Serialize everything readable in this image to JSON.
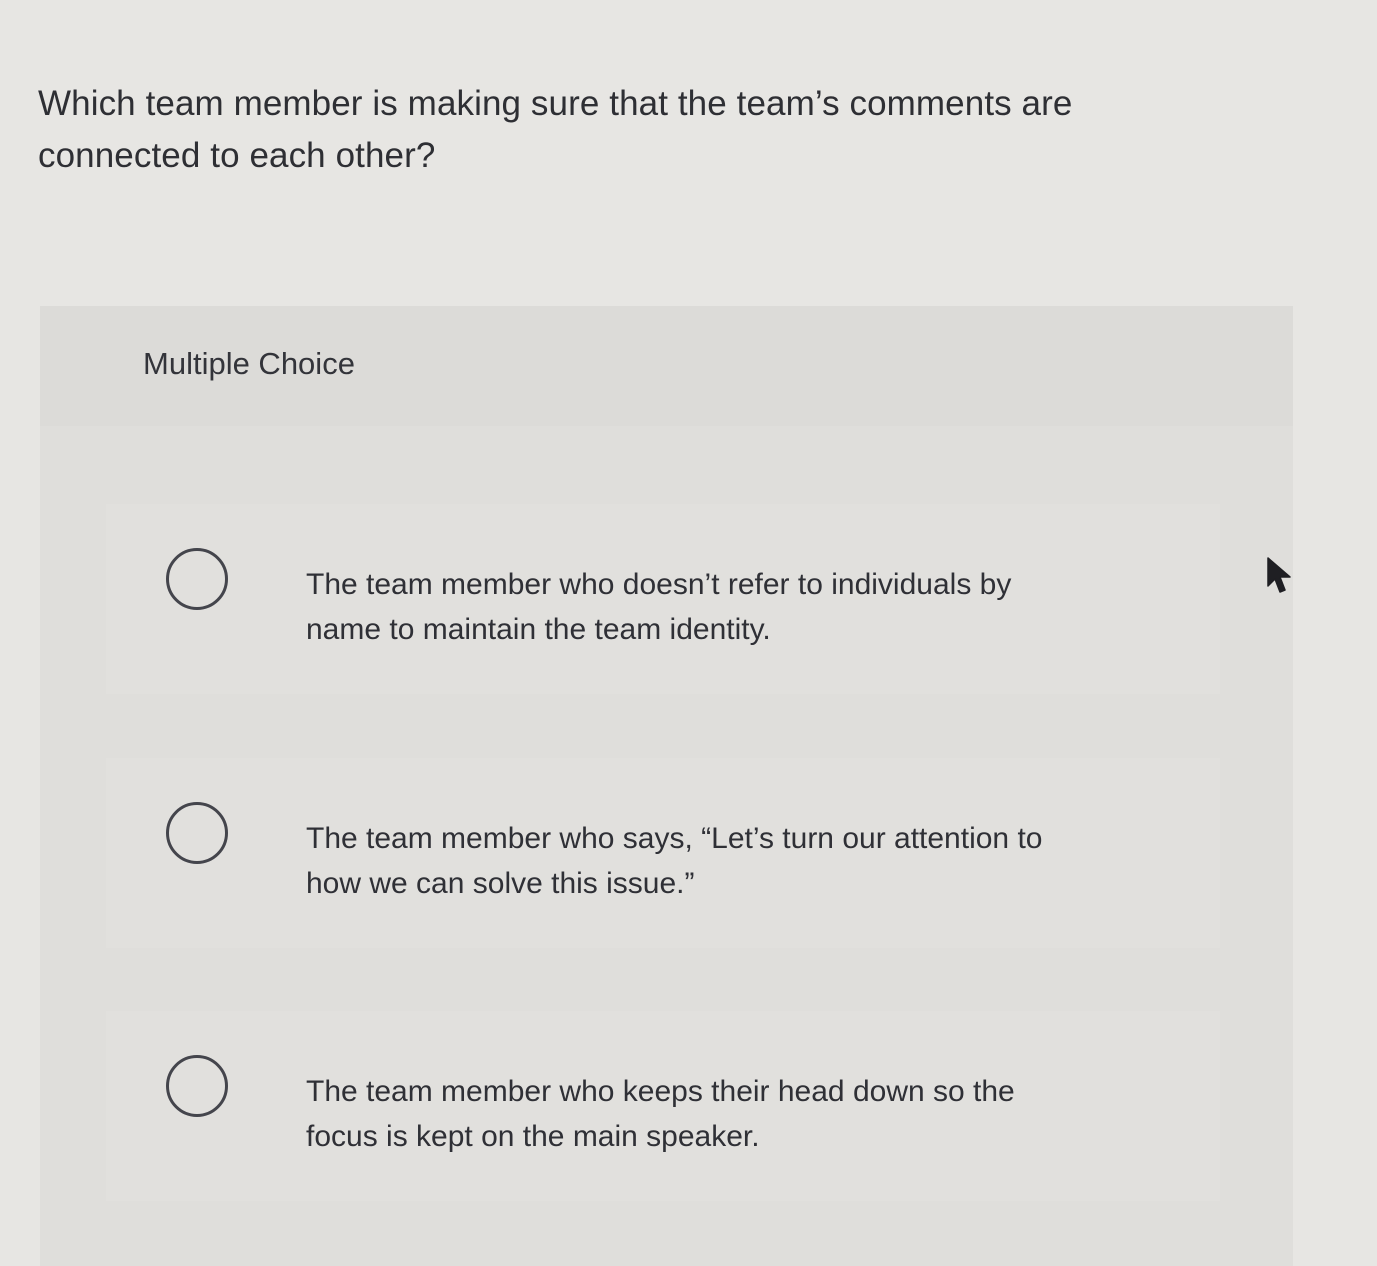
{
  "question": {
    "text": "Which team member is making sure that the team’s comments are connected to each other?"
  },
  "multiple_choice": {
    "label": "Multiple Choice",
    "options": [
      {
        "text": "The team member who doesn’t refer to individuals by name to maintain the team identity."
      },
      {
        "text": "The team member who says, “Let’s turn our attention to how we can solve this issue.”"
      },
      {
        "text": "The team member who keeps their head down so the focus is kept on the main speaker."
      }
    ]
  },
  "icons": {
    "radio": "radio-unchecked-icon",
    "cursor": "mouse-pointer-icon"
  },
  "colors": {
    "background": "#e7e6e3",
    "panel": "#dfdedb",
    "text": "#2f3036",
    "radio_border": "#44454c"
  }
}
